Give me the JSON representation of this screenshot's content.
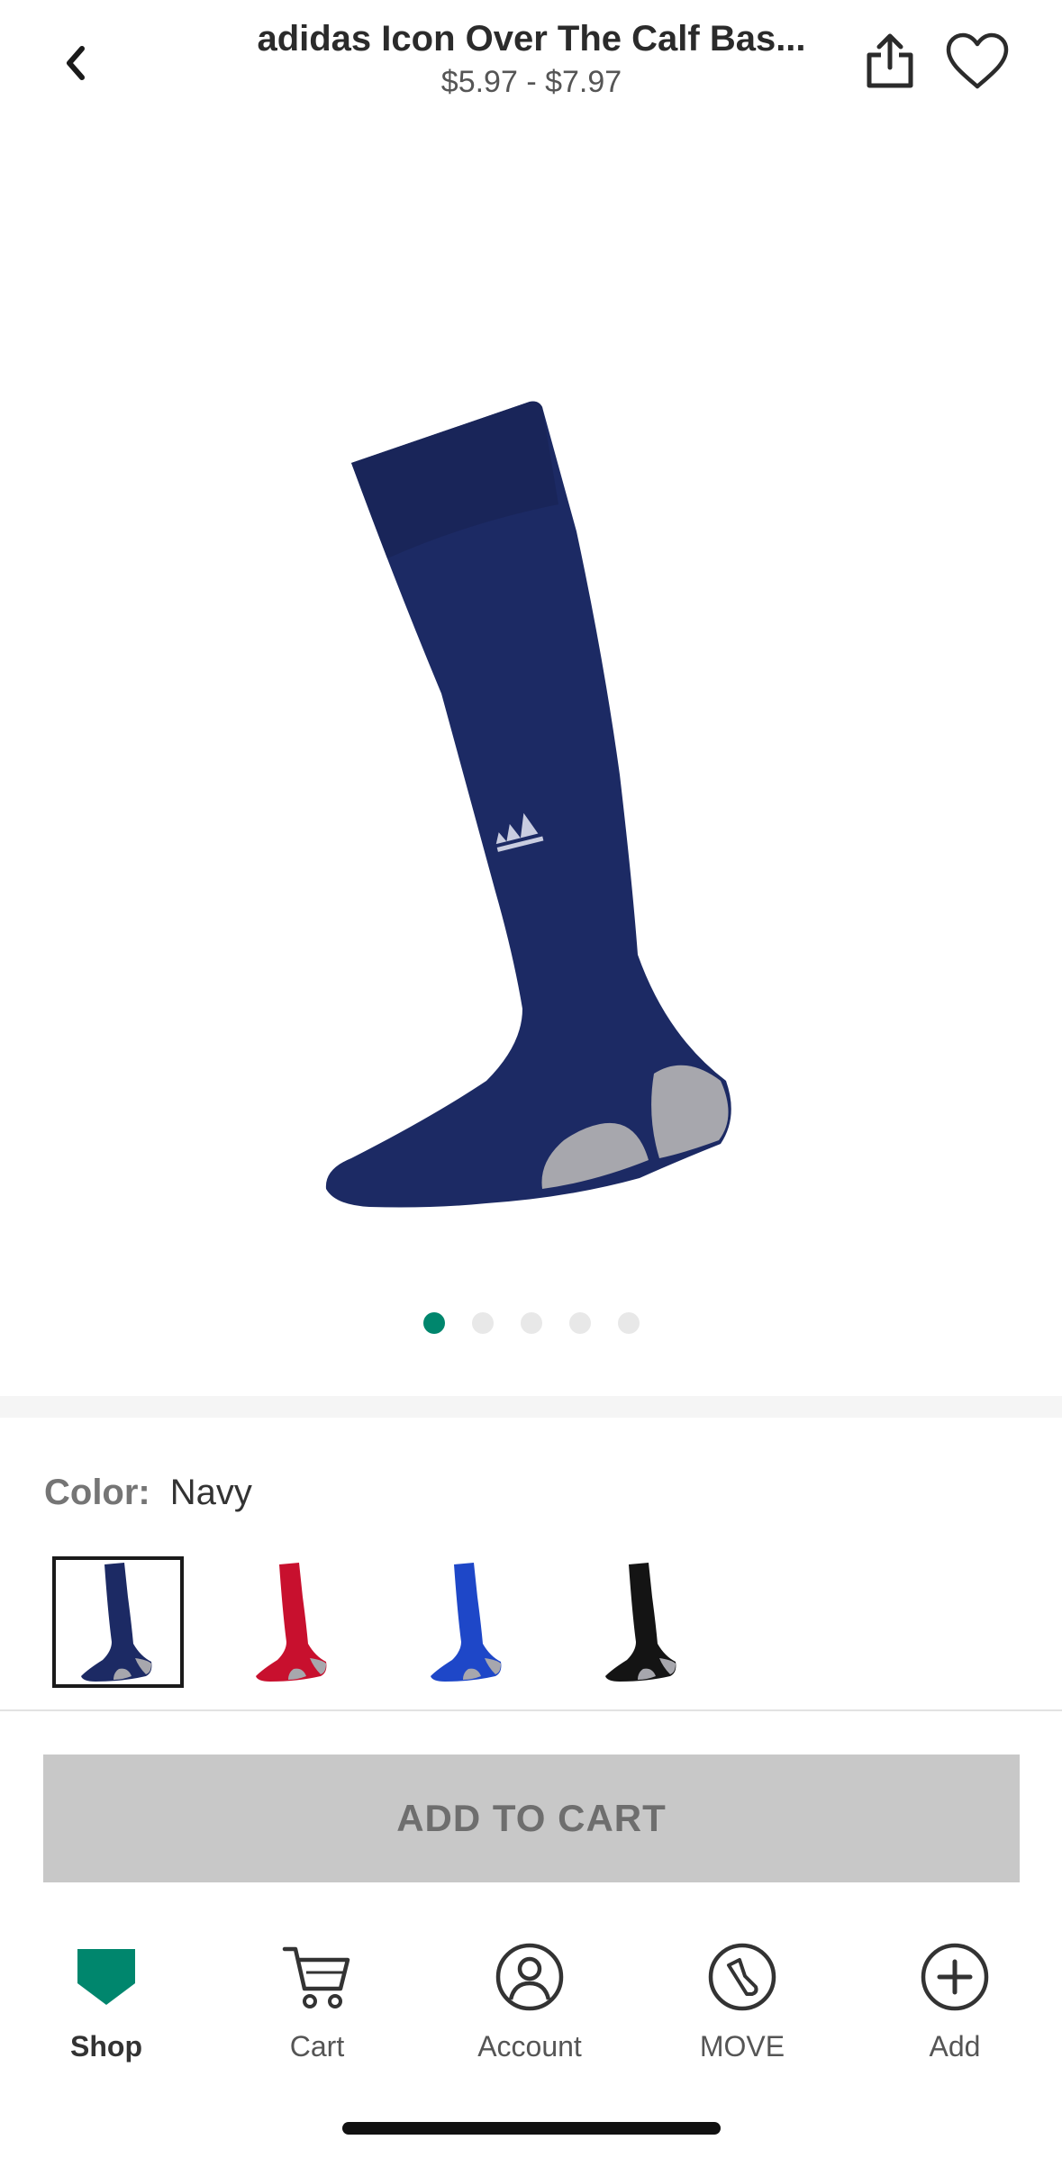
{
  "header": {
    "title": "adidas Icon Over The Calf Bas...",
    "price_range": "$5.97 - $7.97"
  },
  "icons": {
    "back": "chevron-left-icon",
    "share": "share-icon",
    "favorite": "heart-icon"
  },
  "gallery": {
    "image_count": 5,
    "active_index": 0
  },
  "color": {
    "label": "Color:",
    "selected": "Navy",
    "options": [
      "Navy",
      "Red",
      "Royal Blue",
      "Black"
    ]
  },
  "colors": {
    "navy": "#1c2a64",
    "red": "#c8102e",
    "royal": "#1e47c8",
    "black": "#141414",
    "accent": "#00866d"
  },
  "cart": {
    "add_label": "ADD TO CART"
  },
  "nav": {
    "shop": "Shop",
    "cart": "Cart",
    "account": "Account",
    "move": "MOVE",
    "add": "Add"
  }
}
